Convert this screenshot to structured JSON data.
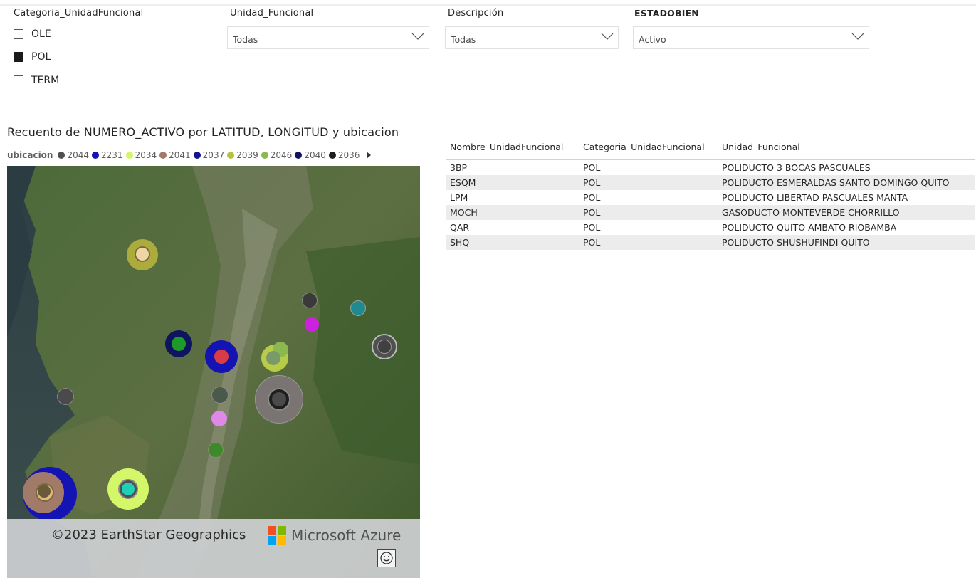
{
  "slicers": {
    "categoria": {
      "title": "Categoria_UnidadFuncional",
      "options": [
        {
          "label": "OLE",
          "checked": false
        },
        {
          "label": "POL",
          "checked": true
        },
        {
          "label": "TERM",
          "checked": false
        }
      ]
    },
    "unidad": {
      "title": "Unidad_Funcional",
      "value": "Todas"
    },
    "descripcion": {
      "title": "Descripción",
      "value": "Todas"
    },
    "estado": {
      "title": "ESTADOBIEN",
      "value": "Activo"
    }
  },
  "map_visual": {
    "title": "Recuento de NUMERO_ACTIVO por LATITUD, LONGITUD y ubicacion",
    "legend_title": "ubicacion",
    "legend": [
      {
        "label": "2044",
        "color": "#505050"
      },
      {
        "label": "2231",
        "color": "#1414b4"
      },
      {
        "label": "2034",
        "color": "#d4f76a"
      },
      {
        "label": "2041",
        "color": "#a27a6a"
      },
      {
        "label": "2037",
        "color": "#14148c"
      },
      {
        "label": "2039",
        "color": "#b5c33c"
      },
      {
        "label": "2046",
        "color": "#8cb850"
      },
      {
        "label": "2040",
        "color": "#0f1460"
      },
      {
        "label": "2036",
        "color": "#1e1e1e"
      }
    ],
    "copyright": "©2023 EarthStar Geographics",
    "brand": "Microsoft Azure",
    "feedback_icon": "smiley-icon"
  },
  "table_visual": {
    "headers": [
      "Nombre_UnidadFuncional",
      "Categoria_UnidadFuncional",
      "Unidad_Funcional"
    ],
    "rows": [
      [
        "3BP",
        "POL",
        "POLIDUCTO 3 BOCAS PASCUALES"
      ],
      [
        "ESQM",
        "POL",
        "POLIDUCTO ESMERALDAS SANTO DOMINGO QUITO"
      ],
      [
        "LPM",
        "POL",
        "POLIDUCTO LIBERTAD PASCUALES MANTA"
      ],
      [
        "MOCH",
        "POL",
        "GASODUCTO MONTEVERDE CHORRILLO"
      ],
      [
        "QAR",
        "POL",
        "POLIDUCTO QUITO AMBATO RIOBAMBA"
      ],
      [
        "SHQ",
        "POL",
        "POLIDUCTO SHUSHUFINDI QUITO"
      ]
    ]
  }
}
